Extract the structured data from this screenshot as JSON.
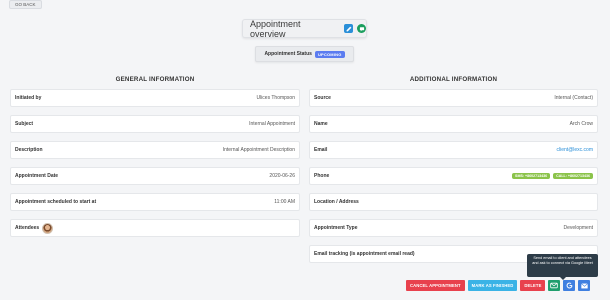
{
  "back_button": "GO BACK",
  "overview": {
    "title": "Appointment overview",
    "status_label": "Appointment Status",
    "status_value": "UPCOMING"
  },
  "general": {
    "heading": "GENERAL INFORMATION",
    "rows": [
      {
        "label": "Initiated by",
        "value": "Ulices Thompson"
      },
      {
        "label": "Subject",
        "value": "Internal Appointment"
      },
      {
        "label": "Description",
        "value": "Internal Appointment Description"
      },
      {
        "label": "Appointment Date",
        "value": "2020-06-26"
      },
      {
        "label": "Appointment scheduled to start at",
        "value": "11:00 AM"
      },
      {
        "label": "Attendees",
        "value": ""
      }
    ]
  },
  "additional": {
    "heading": "ADDITIONAL INFORMATION",
    "rows": [
      {
        "label": "Source",
        "value": "Internal (Contact)"
      },
      {
        "label": "Name",
        "value": "Arch Crow"
      },
      {
        "label": "Email",
        "value": "client@lexc.com"
      },
      {
        "label": "Phone",
        "sms": "SMS: +8602713436",
        "call": "CALL: +8602713436"
      },
      {
        "label": "Location / Address",
        "value": ""
      },
      {
        "label": "Appointment Type",
        "value": "Development"
      },
      {
        "label": "Email tracking (is appointment email read)",
        "value": ""
      }
    ]
  },
  "tooltip": "Send email to client and attendees and ask to connect via Google Meet",
  "actions": {
    "cancel": "CANCEL APPOINTMENT",
    "finish": "MARK AS FINISHED",
    "delete": "DELETE"
  },
  "colors": {
    "status_badge": "#5b7cf0",
    "danger": "#e8414d",
    "info": "#3ab3e6",
    "phone_btn": "#8bc34a",
    "meet_btn": "#1f9e6d",
    "google_btn": "#3f7fe0"
  }
}
